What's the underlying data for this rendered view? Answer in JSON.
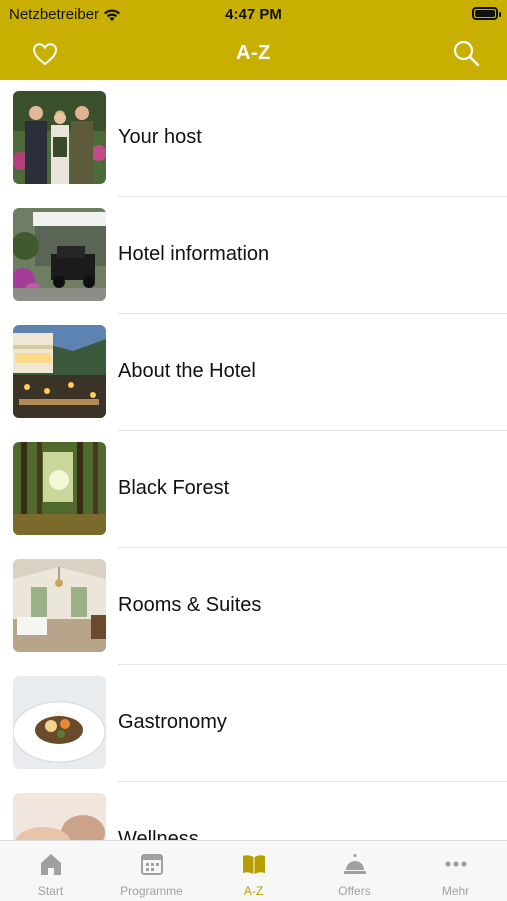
{
  "status_bar": {
    "carrier": "Netzbetreiber",
    "time": "4:47 PM"
  },
  "header": {
    "title": "A-Z",
    "left_icon": "heart-icon",
    "right_icon": "search-icon"
  },
  "colors": {
    "brand": "#c9b000",
    "tab_active": "#b89f00",
    "tab_inactive": "#a0a0a0"
  },
  "list": {
    "items": [
      {
        "label": "Your host",
        "icon": "host-photo"
      },
      {
        "label": "Hotel information",
        "icon": "hotel-entrance-photo"
      },
      {
        "label": "About the Hotel",
        "icon": "hotel-exterior-photo"
      },
      {
        "label": "Black Forest",
        "icon": "forest-photo"
      },
      {
        "label": "Rooms & Suites",
        "icon": "room-photo"
      },
      {
        "label": "Gastronomy",
        "icon": "dish-photo"
      },
      {
        "label": "Wellness",
        "icon": "wellness-photo"
      }
    ]
  },
  "tabbar": {
    "tabs": [
      {
        "label": "Start",
        "icon": "home-icon"
      },
      {
        "label": "Programme",
        "icon": "calendar-icon"
      },
      {
        "label": "A-Z",
        "icon": "book-icon",
        "active": true
      },
      {
        "label": "Offers",
        "icon": "service-bell-icon"
      },
      {
        "label": "Mehr",
        "icon": "more-dots-icon"
      }
    ]
  }
}
